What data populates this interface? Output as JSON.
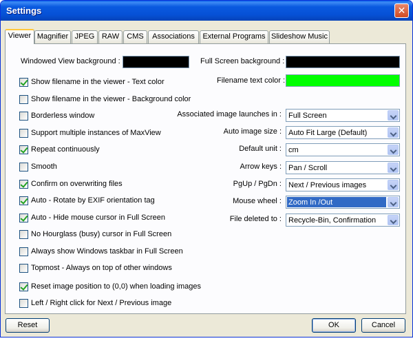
{
  "window": {
    "title": "Settings",
    "close_glyph": "✕"
  },
  "tabs": [
    {
      "label": "Viewer",
      "active": true
    },
    {
      "label": "Magnifier"
    },
    {
      "label": "JPEG"
    },
    {
      "label": "RAW"
    },
    {
      "label": "CMS"
    },
    {
      "label": "Associations"
    },
    {
      "label": "External Programs"
    },
    {
      "label": "Slideshow Music"
    }
  ],
  "colors": {
    "windowed_bg": "#000000",
    "fullscreen_bg": "#000000",
    "filename_text": "#00FF00"
  },
  "left": {
    "windowed_bg_label": "Windowed View background :",
    "checkboxes": [
      {
        "label": "Show filename in the viewer - Text color",
        "checked": true
      },
      {
        "label": "Show filename in the viewer - Background color",
        "checked": false
      },
      {
        "label": "Borderless window",
        "checked": false
      },
      {
        "label": "Support multiple instances of MaxView",
        "checked": false
      },
      {
        "label": "Repeat continuously",
        "checked": true
      },
      {
        "label": "Smooth",
        "checked": false
      },
      {
        "label": "Confirm on overwriting files",
        "checked": true
      },
      {
        "label": "Auto - Rotate by EXIF orientation tag",
        "checked": true
      },
      {
        "label": "Auto - Hide mouse cursor in Full Screen",
        "checked": true
      },
      {
        "label": "No Hourglass (busy) cursor in Full Screen",
        "checked": false
      },
      {
        "label": "Always show Windows taskbar in Full Screen",
        "checked": false
      },
      {
        "label": "Topmost - Always on top of other windows",
        "checked": false
      },
      {
        "label": "Reset image position to (0,0) when loading images",
        "checked": true
      },
      {
        "label": "Left / Right click for Next / Previous image",
        "checked": false
      }
    ]
  },
  "right": {
    "fullscreen_bg_label": "Full Screen background :",
    "filename_color_label": "Filename text color :",
    "dropdowns": [
      {
        "label": "Associated image launches in :",
        "value": "Full Screen"
      },
      {
        "label": "Auto image size :",
        "value": "Auto Fit Large (Default)"
      },
      {
        "label": "Default unit :",
        "value": "cm"
      },
      {
        "label": "Arrow keys :",
        "value": "Pan / Scroll"
      },
      {
        "label": "PgUp / PgDn :",
        "value": "Next / Previous images"
      },
      {
        "label": "Mouse wheel :",
        "value": "Zoom In /Out",
        "focused": true
      },
      {
        "label": "File deleted to :",
        "value": "Recycle-Bin, Confirmation"
      }
    ]
  },
  "buttons": {
    "reset": "Reset",
    "ok": "OK",
    "cancel": "Cancel"
  }
}
